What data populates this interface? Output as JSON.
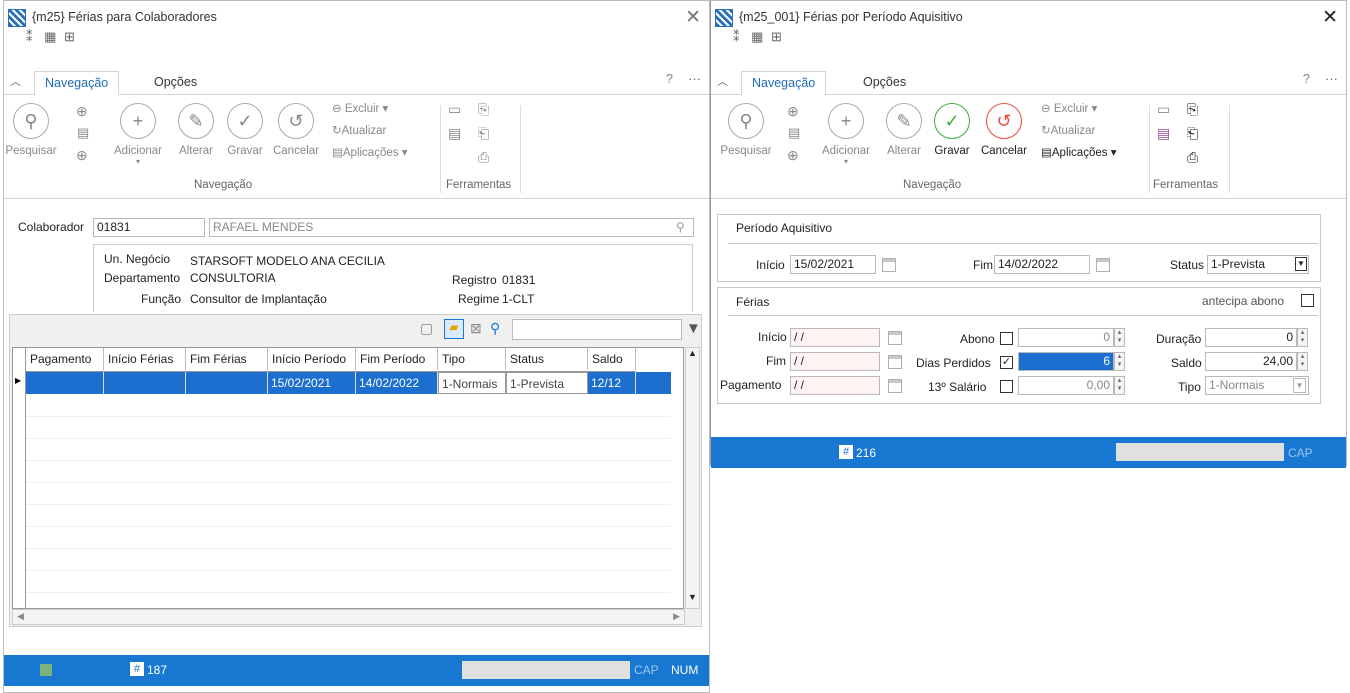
{
  "colors": {
    "accent": "#1777d1",
    "selected": "#1c6fcf",
    "green": "#3cb043",
    "red": "#e74c3c"
  },
  "window1": {
    "title": "{m25}  Férias para Colaboradores",
    "tabs": {
      "navegacao": "Navegação",
      "opcoes": "Opções"
    },
    "ribbon": {
      "pesquisar": "Pesquisar",
      "adicionar": "Adicionar",
      "alterar": "Alterar",
      "gravar": "Gravar",
      "cancelar": "Cancelar",
      "excluir": "Excluir",
      "atualizar": "Atualizar",
      "aplicacoes": "Aplicações",
      "group_navegacao": "Navegação",
      "group_ferramentas": "Ferramentas"
    },
    "colaborador_label": "Colaborador",
    "colaborador_code": "01831",
    "colaborador_name": "RAFAEL MENDES",
    "info": {
      "un_negocio_label": "Un. Negócio",
      "un_negocio": "STARSOFT MODELO ANA CECILIA",
      "departamento_label": "Departamento",
      "departamento": "CONSULTORIA",
      "funcao_label": "Função",
      "funcao": "Consultor de Implantação",
      "registro_label": "Registro",
      "registro": "01831",
      "regime_label": "Regime",
      "regime": "1-CLT"
    },
    "grid": {
      "columns": [
        "Pagamento",
        "Início Férias",
        "Fim Férias",
        "Início Período",
        "Fim Período",
        "Tipo",
        "Status",
        "Saldo"
      ],
      "rows": [
        [
          "",
          "",
          "",
          "15/02/2021",
          "14/02/2022",
          "1-Normais",
          "1-Prevista",
          "12/12"
        ]
      ]
    },
    "status": {
      "record": "187",
      "cap": "CAP",
      "num": "NUM"
    }
  },
  "window2": {
    "title": "{m25_001}  Férias por Período Aquisitivo",
    "tabs": {
      "navegacao": "Navegação",
      "opcoes": "Opções"
    },
    "ribbon": {
      "pesquisar": "Pesquisar",
      "adicionar": "Adicionar",
      "alterar": "Alterar",
      "gravar": "Gravar",
      "cancelar": "Cancelar",
      "excluir": "Excluir",
      "atualizar": "Atualizar",
      "aplicacoes": "Aplicações",
      "group_navegacao": "Navegação",
      "group_ferramentas": "Ferramentas"
    },
    "periodo": {
      "title": "Período Aquisitivo",
      "inicio_label": "Início",
      "inicio": "15/02/2021",
      "fim_label": "Fim",
      "fim": "14/02/2022",
      "status_label": "Status",
      "status": "1-Prevista"
    },
    "ferias": {
      "title": "Férias",
      "antecipa_label": "antecipa abono",
      "inicio_label": "Início",
      "inicio": " /  /",
      "fim_label": "Fim",
      "fim": " /  /",
      "pagamento_label": "Pagamento",
      "pagamento": " /  /",
      "abono_label": "Abono",
      "abono": "0",
      "dias_perdidos_label": "Dias Perdidos",
      "dias_perdidos": "6",
      "salario13_label": "13º Salário",
      "salario13": "0,00",
      "duracao_label": "Duração",
      "duracao": "0",
      "saldo_label": "Saldo",
      "saldo": "24,00",
      "tipo_label": "Tipo",
      "tipo": "1-Normais"
    },
    "status": {
      "record": "216",
      "cap": "CAP"
    }
  }
}
